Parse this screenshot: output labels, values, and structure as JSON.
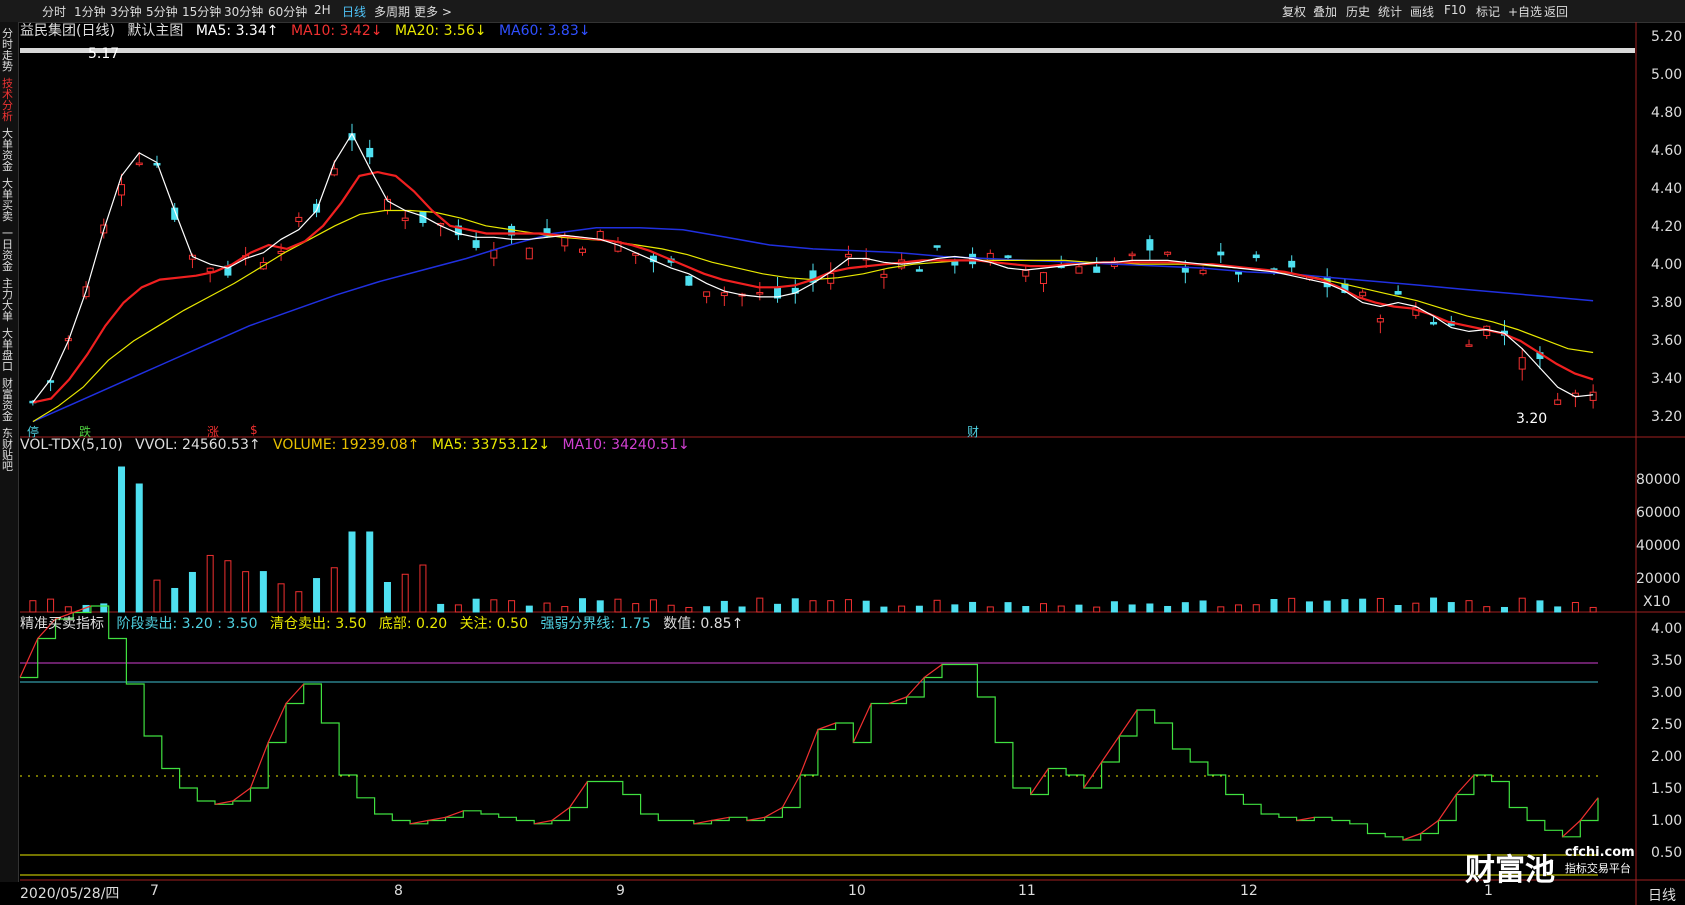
{
  "topbar": {
    "timeframes": [
      "分时",
      "1分钟",
      "3分钟",
      "5分钟",
      "15分钟",
      "30分钟",
      "60分钟",
      "2H",
      "日线",
      "多周期",
      "更多 >"
    ],
    "active": "日线",
    "right_buttons": [
      "复权",
      "叠加",
      "历史",
      "统计",
      "画线",
      "F10",
      "标记",
      "+自选",
      "返回"
    ]
  },
  "leftnav": [
    "分时走势",
    "技术分析",
    "大单资金",
    "大单买卖",
    "一日资金",
    "主力大单",
    "大单盘口",
    "财富资金",
    "东财贴吧"
  ],
  "main_legend": {
    "name": "益民集团(日线)",
    "indicator": "默认主图",
    "ma5": "MA5: 3.34↑",
    "ma10": "MA10: 3.42↓",
    "ma20": "MA20: 3.56↓",
    "ma60": "MA60: 3.83↓"
  },
  "vol_legend": {
    "name": "VOL-TDX(5,10)",
    "vvol": "VVOL: 24560.53↑",
    "volume": "VOLUME: 19239.08↑",
    "ma5": "MA5: 33753.12↓",
    "ma10": "MA10: 34240.51↓"
  },
  "ind_legend": {
    "name": "精准买卖指标",
    "stage": "阶段卖出: 3.20 : 3.50",
    "clear": "清仓卖出: 3.50",
    "bottom": "底部: 0.20",
    "watch": "关注: 0.50",
    "line": "强弱分界线: 1.75",
    "value": "数值: 0.85↑"
  },
  "price_axis": [
    "5.20",
    "5.00",
    "4.80",
    "4.60",
    "4.40",
    "4.20",
    "4.00",
    "3.80",
    "3.60",
    "3.40",
    "3.20"
  ],
  "vol_axis": [
    "80000",
    "60000",
    "40000",
    "20000",
    "X10"
  ],
  "ind_axis": [
    "4.00",
    "3.50",
    "3.00",
    "2.50",
    "2.00",
    "1.50",
    "1.00",
    "0.50"
  ],
  "date_axis": {
    "first": "2020/05/28/四",
    "months": [
      "7",
      "8",
      "9",
      "10",
      "11",
      "12",
      "1"
    ],
    "period": "日线"
  },
  "annotations": {
    "high": "5.17",
    "low": "3.20",
    "markers": [
      "停",
      "跌",
      "涨",
      "$",
      "财"
    ]
  },
  "watermark": {
    "brand": "财富池",
    "site": "cfchi.com",
    "sub": "指标交易平台"
  },
  "chart_data": {
    "type": "candlestick",
    "ylim": [
      3.12,
      5.24
    ],
    "ma5": [
      3.3,
      3.42,
      3.62,
      3.88,
      4.2,
      4.48,
      4.6,
      4.55,
      4.3,
      4.06,
      4.02,
      4.0,
      4.05,
      4.08,
      4.15,
      4.2,
      4.3,
      4.55,
      4.7,
      4.52,
      4.35,
      4.3,
      4.27,
      4.22,
      4.18,
      4.16,
      4.16,
      4.15,
      4.15,
      4.16,
      4.17,
      4.16,
      4.15,
      4.12,
      4.08,
      4.04,
      4.0,
      3.97,
      3.92,
      3.88,
      3.86,
      3.85,
      3.85,
      3.87,
      3.92,
      3.98,
      4.05,
      4.05,
      4.03,
      4.02,
      4.03,
      4.05,
      4.06,
      4.05,
      4.03,
      4.0,
      3.99,
      4.0,
      4.01,
      4.02,
      4.03,
      4.03,
      4.04,
      4.04,
      4.04,
      4.03,
      4.02,
      4.01,
      4.0,
      3.99,
      3.98,
      3.96,
      3.94,
      3.92,
      3.88,
      3.82,
      3.8,
      3.82,
      3.8,
      3.75,
      3.69,
      3.67,
      3.68,
      3.66,
      3.58,
      3.48,
      3.38,
      3.33,
      3.34
    ],
    "ma10": [
      3.3,
      3.32,
      3.42,
      3.55,
      3.7,
      3.82,
      3.9,
      3.94,
      3.95,
      3.96,
      3.98,
      4.02,
      4.08,
      4.12,
      4.1,
      4.14,
      4.22,
      4.34,
      4.48,
      4.5,
      4.48,
      4.4,
      4.3,
      4.22,
      4.2,
      4.18,
      4.18,
      4.18,
      4.18,
      4.17,
      4.16,
      4.15,
      4.14,
      4.12,
      4.09,
      4.05,
      4.01,
      3.97,
      3.94,
      3.92,
      3.9,
      3.9,
      3.91,
      3.94,
      3.98,
      4.0,
      4.01,
      4.02,
      4.03,
      4.04,
      4.04,
      4.04,
      4.04,
      4.03,
      4.02,
      4.01,
      4.01,
      4.02,
      4.02,
      4.03,
      4.03,
      4.03,
      4.03,
      4.03,
      4.02,
      4.02,
      4.01,
      4.0,
      3.99,
      3.98,
      3.96,
      3.94,
      3.9,
      3.85,
      3.82,
      3.8,
      3.79,
      3.76,
      3.72,
      3.7,
      3.68,
      3.66,
      3.62,
      3.56,
      3.5,
      3.45,
      3.42
    ],
    "ma20": [
      3.2,
      3.28,
      3.38,
      3.52,
      3.62,
      3.7,
      3.78,
      3.85,
      3.92,
      4.0,
      4.08,
      4.15,
      4.22,
      4.28,
      4.3,
      4.3,
      4.29,
      4.26,
      4.22,
      4.2,
      4.18,
      4.16,
      4.15,
      4.14,
      4.12,
      4.1,
      4.07,
      4.03,
      4.0,
      3.97,
      3.95,
      3.94,
      3.95,
      3.97,
      4.0,
      4.02,
      4.03,
      4.04,
      4.04,
      4.04,
      4.04,
      4.04,
      4.03,
      4.03,
      4.02,
      4.02,
      4.02,
      4.01,
      4.0,
      3.99,
      3.97,
      3.95,
      3.92,
      3.89,
      3.86,
      3.83,
      3.79,
      3.75,
      3.72,
      3.68,
      3.63,
      3.58,
      3.56
    ],
    "ma60": [
      3.2,
      3.3,
      3.4,
      3.5,
      3.6,
      3.7,
      3.78,
      3.86,
      3.93,
      3.99,
      4.05,
      4.12,
      4.18,
      4.21,
      4.21,
      4.2,
      4.16,
      4.12,
      4.1,
      4.09,
      4.08,
      4.06,
      4.05,
      4.04,
      4.03,
      4.02,
      4.01,
      4.0,
      3.98,
      3.97,
      3.95,
      3.93,
      3.91,
      3.89,
      3.87,
      3.85,
      3.83
    ]
  }
}
